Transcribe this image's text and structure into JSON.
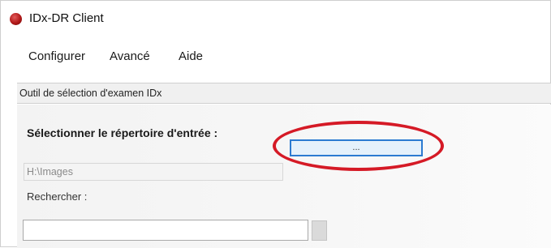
{
  "window": {
    "title": "IDx-DR Client"
  },
  "menubar": {
    "items": [
      {
        "label": "Configurer"
      },
      {
        "label": "Avancé"
      },
      {
        "label": "Aide"
      }
    ]
  },
  "tool_header": {
    "title": "Outil de sélection d'examen IDx"
  },
  "input_directory": {
    "label": "Sélectionner le répertoire d'entrée :",
    "browse_label": "...",
    "current_path": "H:\\Images"
  },
  "search": {
    "label": "Rechercher :",
    "value": ""
  },
  "colors": {
    "highlight": "#d51a26",
    "button_border": "#2c7bd1",
    "icon": "#b01818"
  },
  "icons": {
    "app_icon": "app-icon"
  }
}
